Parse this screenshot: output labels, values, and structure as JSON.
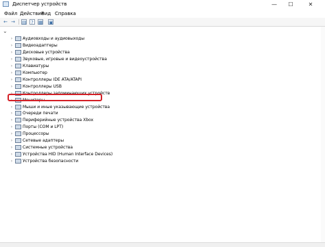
{
  "window": {
    "title": "Диспетчер устройств",
    "minimize": "—",
    "maximize": "☐",
    "close": "✕"
  },
  "menu": {
    "file": "Файл",
    "action": "Действие",
    "view": "Вид",
    "help": "Справка"
  },
  "toolbar": {
    "back": "←",
    "forward": "→",
    "props": "▤",
    "help": "?",
    "update": "▦",
    "monitor": "▣"
  },
  "tree": {
    "root_toggle": "⌄",
    "items": [
      {
        "label": "Аудиовходы и аудиовыходы",
        "icon": "audio-io-icon"
      },
      {
        "label": "Видеоадаптеры",
        "icon": "display-adapter-icon"
      },
      {
        "label": "Дисковые устройства",
        "icon": "disk-drive-icon"
      },
      {
        "label": "Звуковые, игровые и видеоустройства",
        "icon": "sound-icon"
      },
      {
        "label": "Клавиатуры",
        "icon": "keyboard-icon"
      },
      {
        "label": "Компьютер",
        "icon": "computer-icon"
      },
      {
        "label": "Контроллеры IDE ATA/ATAPI",
        "icon": "ide-controller-icon"
      },
      {
        "label": "Контроллеры USB",
        "icon": "usb-icon"
      },
      {
        "label": "Контроллеры запоминающих устройств",
        "icon": "storage-controller-icon"
      },
      {
        "label": "Мониторы",
        "icon": "monitor-icon"
      },
      {
        "label": "Мыши и иные указывающие устройства",
        "icon": "mouse-icon"
      },
      {
        "label": "Очереди печати",
        "icon": "print-queue-icon"
      },
      {
        "label": "Периферийные устройства Xbox",
        "icon": "xbox-icon"
      },
      {
        "label": "Порты (COM и LPT)",
        "icon": "port-icon"
      },
      {
        "label": "Процессоры",
        "icon": "processor-icon"
      },
      {
        "label": "Сетевые адаптеры",
        "icon": "network-icon"
      },
      {
        "label": "Системные устройства",
        "icon": "system-device-icon"
      },
      {
        "label": "Устройства HID (Human Interface Devices)",
        "icon": "hid-icon"
      },
      {
        "label": "Устройства безопасности",
        "icon": "security-device-icon"
      }
    ]
  },
  "colors": {
    "highlight": "#d41f26"
  }
}
